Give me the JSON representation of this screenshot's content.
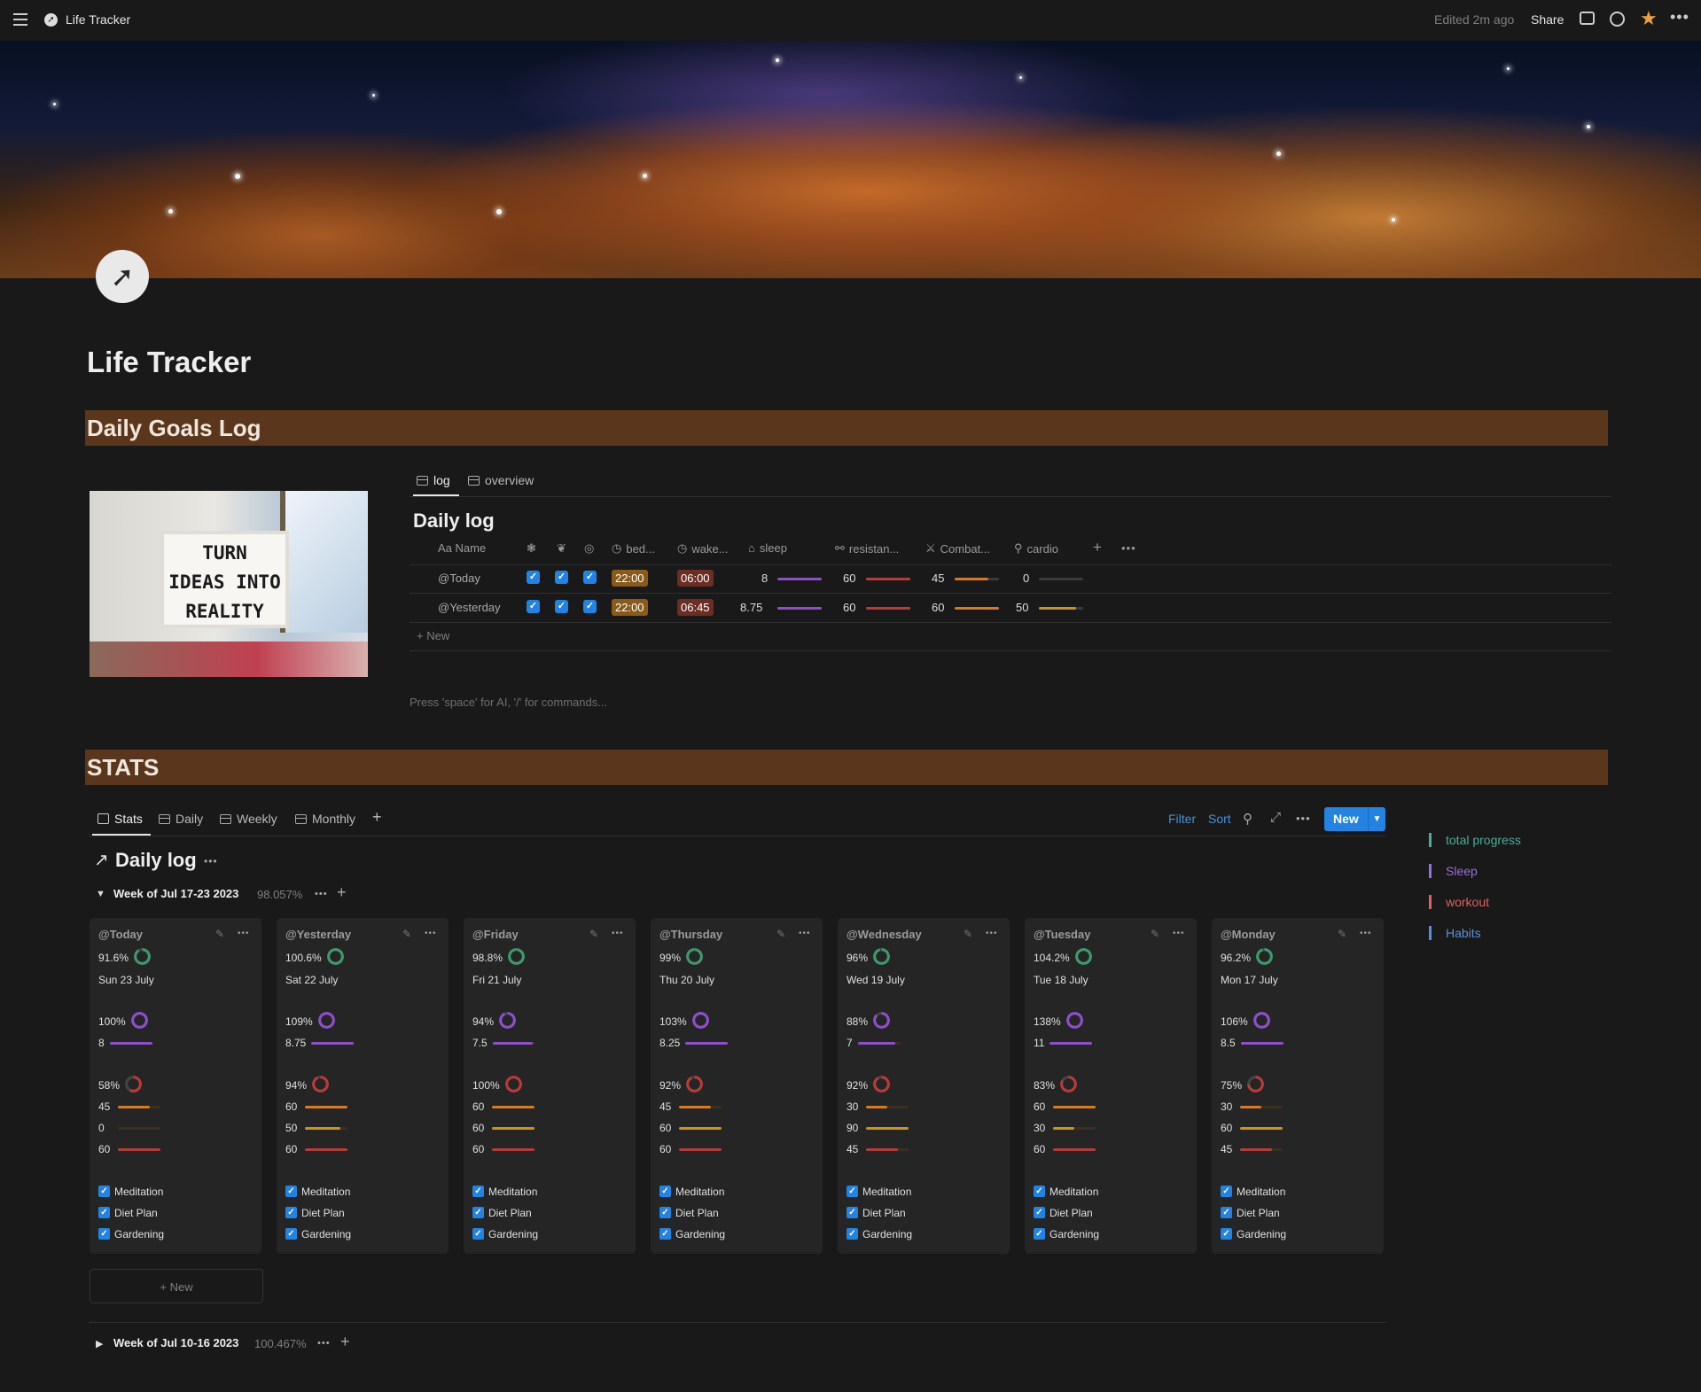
{
  "topbar": {
    "title": "Life Tracker",
    "edited": "Edited 2m ago",
    "share": "Share"
  },
  "page": {
    "title": "Life Tracker"
  },
  "goals": {
    "header": "Daily Goals Log",
    "image_text": [
      "TURN",
      "IDEAS INTO",
      "REALITY"
    ],
    "tabs": [
      {
        "label": "log"
      },
      {
        "label": "overview"
      }
    ],
    "db_title": "Daily log",
    "columns": {
      "name": "Aa Name",
      "bed": "bed...",
      "wake": "wake...",
      "sleep": "sleep",
      "resist": "resistan...",
      "combat": "Combat...",
      "cardio": "cardio"
    },
    "rows": [
      {
        "name": "@Today",
        "bed": "22:00",
        "wake": "06:00",
        "sleep": "8",
        "resist": "60",
        "combat": "45",
        "cardio": "0",
        "sleep_frac": 1.0,
        "resist_frac": 1.0,
        "combat_frac": 0.75,
        "cardio_frac": 0.0
      },
      {
        "name": "@Yesterday",
        "bed": "22:00",
        "wake": "06:45",
        "sleep": "8.75",
        "resist": "60",
        "combat": "60",
        "cardio": "50",
        "sleep_frac": 1.0,
        "resist_frac": 1.0,
        "combat_frac": 1.0,
        "cardio_frac": 0.83
      }
    ],
    "new_label": "New",
    "hint": "Press 'space' for AI, '/' for commands..."
  },
  "stats": {
    "header": "STATS",
    "tabs": [
      {
        "label": "Stats"
      },
      {
        "label": "Daily"
      },
      {
        "label": "Weekly"
      },
      {
        "label": "Monthly"
      }
    ],
    "toolbar": {
      "filter": "Filter",
      "sort": "Sort",
      "new": "New"
    },
    "db_title": "Daily log",
    "week1": {
      "label": "Week of Jul 17-23 2023",
      "pct": "98.057%"
    },
    "week2": {
      "label": "Week of Jul 10-16 2023",
      "pct": "100.467%"
    },
    "new_card": "New",
    "habits": [
      "Meditation",
      "Diet Plan",
      "Gardening"
    ],
    "cards": [
      {
        "title": "@Today",
        "total": "91.6%",
        "date": "Sun 23 July",
        "sleep_pct": "100%",
        "sleep": "8",
        "workout_pct": "58%",
        "w1": "45",
        "w2": "0",
        "w3": "60",
        "total_frac": 0.916,
        "sleep_frac": 1.0,
        "workout_frac": 0.58,
        "w1_frac": 0.75,
        "w2_frac": 0.0,
        "w3_frac": 1.0
      },
      {
        "title": "@Yesterday",
        "total": "100.6%",
        "date": "Sat 22 July",
        "sleep_pct": "109%",
        "sleep": "8.75",
        "workout_pct": "94%",
        "w1": "60",
        "w2": "50",
        "w3": "60",
        "total_frac": 1.0,
        "sleep_frac": 1.0,
        "workout_frac": 0.94,
        "w1_frac": 1.0,
        "w2_frac": 0.83,
        "w3_frac": 1.0
      },
      {
        "title": "@Friday",
        "total": "98.8%",
        "date": "Fri 21 July",
        "sleep_pct": "94%",
        "sleep": "7.5",
        "workout_pct": "100%",
        "w1": "60",
        "w2": "60",
        "w3": "60",
        "total_frac": 0.988,
        "sleep_frac": 0.94,
        "workout_frac": 1.0,
        "w1_frac": 1.0,
        "w2_frac": 1.0,
        "w3_frac": 1.0
      },
      {
        "title": "@Thursday",
        "total": "99%",
        "date": "Thu 20 July",
        "sleep_pct": "103%",
        "sleep": "8.25",
        "workout_pct": "92%",
        "w1": "45",
        "w2": "60",
        "w3": "60",
        "total_frac": 0.99,
        "sleep_frac": 1.0,
        "workout_frac": 0.92,
        "w1_frac": 0.75,
        "w2_frac": 1.0,
        "w3_frac": 1.0
      },
      {
        "title": "@Wednesday",
        "total": "96%",
        "date": "Wed 19 July",
        "sleep_pct": "88%",
        "sleep": "7",
        "workout_pct": "92%",
        "w1": "30",
        "w2": "90",
        "w3": "45",
        "total_frac": 0.96,
        "sleep_frac": 0.88,
        "workout_frac": 0.92,
        "w1_frac": 0.5,
        "w2_frac": 1.0,
        "w3_frac": 0.75
      },
      {
        "title": "@Tuesday",
        "total": "104.2%",
        "date": "Tue 18 July",
        "sleep_pct": "138%",
        "sleep": "11",
        "workout_pct": "83%",
        "w1": "60",
        "w2": "30",
        "w3": "60",
        "total_frac": 1.0,
        "sleep_frac": 1.0,
        "workout_frac": 0.83,
        "w1_frac": 1.0,
        "w2_frac": 0.5,
        "w3_frac": 1.0
      },
      {
        "title": "@Monday",
        "total": "96.2%",
        "date": "Mon 17 July",
        "sleep_pct": "106%",
        "sleep": "8.5",
        "workout_pct": "75%",
        "w1": "30",
        "w2": "60",
        "w3": "45",
        "total_frac": 0.962,
        "sleep_frac": 1.0,
        "workout_frac": 0.75,
        "w1_frac": 0.5,
        "w2_frac": 1.0,
        "w3_frac": 0.75
      }
    ],
    "legend": [
      {
        "label": "total progress",
        "color": "#4dab9a"
      },
      {
        "label": "Sleep",
        "color": "#9a6dd7"
      },
      {
        "label": "workout",
        "color": "#e06060"
      },
      {
        "label": "Habits",
        "color": "#5a8fd8"
      }
    ]
  },
  "colors": {
    "accent": "#2383e2",
    "header_bg": "#5a371c",
    "bed_pill": "#8a5a1a",
    "wake_pill": "#6b2e24",
    "sleep_bar": "#8e4fc9",
    "resist_bar": "#b83b3b",
    "combat_bar": "#d67b1e",
    "cardio_bar": "#c9921e",
    "total_ring": "#3f9a6b"
  }
}
